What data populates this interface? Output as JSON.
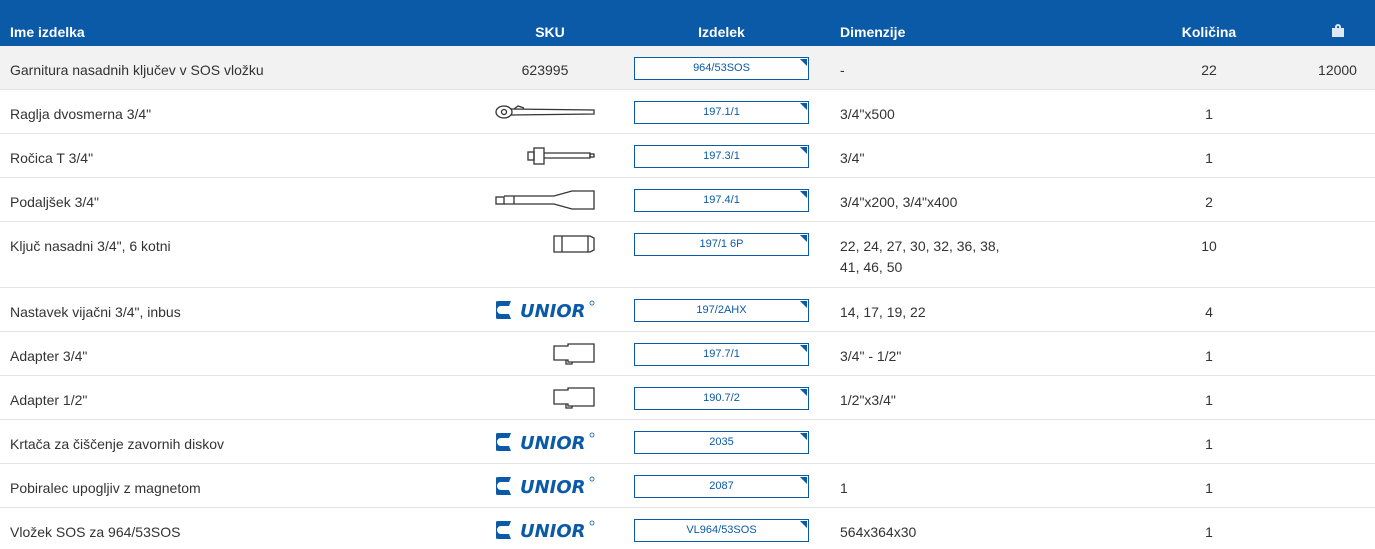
{
  "columns": {
    "name": "Ime izdelka",
    "sku": "SKU",
    "product": "Izdelek",
    "dimensions": "Dimenzije",
    "quantity": "Količina"
  },
  "rows": [
    {
      "name": "Garnitura nasadnih ključev v SOS vložku",
      "sku": "623995",
      "image": "",
      "product": "964/53SOS",
      "dimensions": "-",
      "quantity": "22",
      "weight": "12000"
    },
    {
      "name": "Raglja dvosmerna 3/4\"",
      "sku": "",
      "image": "ratchet",
      "product": "197.1/1",
      "dimensions": "3/4\"x500",
      "quantity": "1",
      "weight": ""
    },
    {
      "name": "Ročica T 3/4\"",
      "sku": "",
      "image": "t-handle",
      "product": "197.3/1",
      "dimensions": "3/4\"",
      "quantity": "1",
      "weight": ""
    },
    {
      "name": "Podaljšek 3/4\"",
      "sku": "",
      "image": "extension",
      "product": "197.4/1",
      "dimensions": "3/4\"x200, 3/4\"x400",
      "quantity": "2",
      "weight": ""
    },
    {
      "name": "Ključ nasadni 3/4\", 6 kotni",
      "sku": "",
      "image": "socket",
      "product": "197/1 6P",
      "dimensions": "22, 24, 27, 30, 32, 36, 38, 41, 46, 50",
      "quantity": "10",
      "weight": ""
    },
    {
      "name": "Nastavek vijačni 3/4\", inbus",
      "sku": "",
      "image": "unior-logo",
      "product": "197/2AHX",
      "dimensions": "14, 17, 19, 22",
      "quantity": "4",
      "weight": ""
    },
    {
      "name": "Adapter 3/4\"",
      "sku": "",
      "image": "adapter",
      "product": "197.7/1",
      "dimensions": "3/4\" - 1/2\"",
      "quantity": "1",
      "weight": ""
    },
    {
      "name": "Adapter 1/2\"",
      "sku": "",
      "image": "adapter",
      "product": "190.7/2",
      "dimensions": "1/2\"x3/4\"",
      "quantity": "1",
      "weight": ""
    },
    {
      "name": "Krtača za čiščenje zavornih diskov",
      "sku": "",
      "image": "unior-logo",
      "product": "2035",
      "dimensions": "",
      "quantity": "1",
      "weight": ""
    },
    {
      "name": "Pobiralec upogljiv z magnetom",
      "sku": "",
      "image": "unior-logo",
      "product": "2087",
      "dimensions": "1",
      "quantity": "1",
      "weight": ""
    },
    {
      "name": "Vložek SOS za 964/53SOS",
      "sku": "",
      "image": "unior-logo",
      "product": "VL964/53SOS",
      "dimensions": "564x364x30",
      "quantity": "1",
      "weight": ""
    }
  ],
  "logo_text": "UNIOR",
  "colors": {
    "header_bg": "#0b5aa8",
    "accent": "#0b5aa8"
  }
}
